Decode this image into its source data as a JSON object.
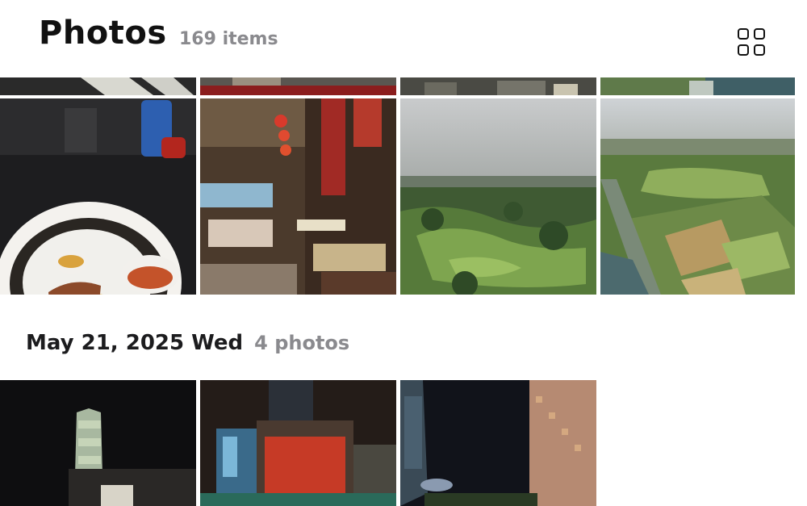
{
  "header": {
    "title": "Photos",
    "count": "169 items",
    "icon": "grid-view-icon"
  },
  "section": {
    "date": "May 21, 2025 Wed",
    "count": "4 photos"
  },
  "photos_top_strip": [
    "photo-strip-1",
    "photo-strip-2",
    "photo-strip-3",
    "photo-strip-4"
  ],
  "photos_row": [
    "tsukemen-meal",
    "night-alley-street",
    "aerial-golf-course",
    "aerial-farmland"
  ],
  "photos_section": [
    "taipei-101-night",
    "mall-billboard-night",
    "tower-and-hotel-night"
  ]
}
